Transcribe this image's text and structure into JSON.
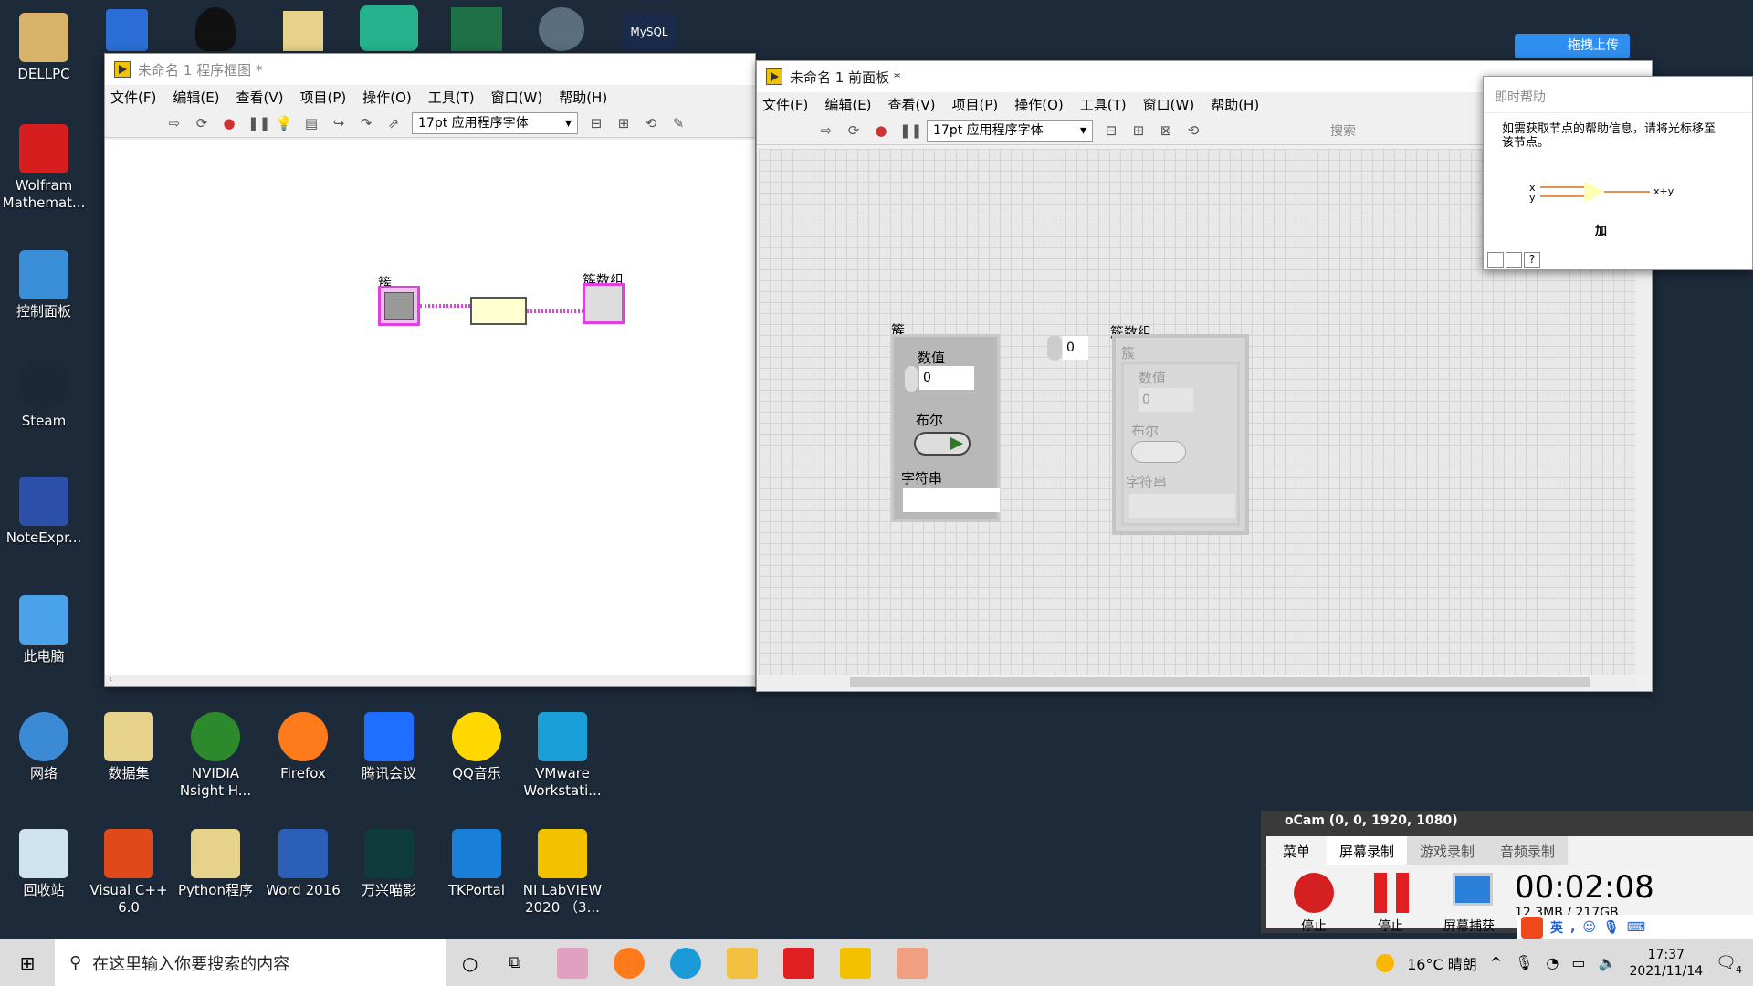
{
  "desktop": {
    "left_icons": [
      "DELLPC",
      "Wolfram Mathemat...",
      "控制面板",
      "Steam",
      "NoteExpr...",
      "此电脑",
      "网络",
      "回收站"
    ],
    "row1": [
      "数据集",
      "NVIDIA Nsight H...",
      "Firefox",
      "腾讯会议",
      "QQ音乐",
      "VMware Workstati..."
    ],
    "row2": [
      "Visual C++ 6.0",
      "Python程序",
      "Word 2016",
      "万兴喵影",
      "TKPortal",
      "NI LabVIEW 2020 （3..."
    ],
    "upload_button": "拖拽上传"
  },
  "menu": [
    "文件(F)",
    "编辑(E)",
    "查看(V)",
    "项目(P)",
    "操作(O)",
    "工具(T)",
    "窗口(W)",
    "帮助(H)"
  ],
  "block_diagram": {
    "title": "未命名 1 程序框图 *",
    "font": "17pt 应用程序字体",
    "cluster_label": "簇",
    "array_label": "簇数组"
  },
  "front_panel": {
    "title": "未命名 1 前面板 *",
    "font": "17pt 应用程序字体",
    "search_placeholder": "搜索",
    "cluster": {
      "label": "簇",
      "numeric_label": "数值",
      "numeric_value": "0",
      "bool_label": "布尔",
      "string_label": "字符串"
    },
    "array": {
      "label": "簇数组",
      "index": "0",
      "cluster_label": "簇",
      "numeric_label": "数值",
      "numeric_value": "0",
      "bool_label": "布尔",
      "string_label": "字符串"
    }
  },
  "context_help": {
    "title": "即时帮助",
    "text": "如需获取节点的帮助信息，请将光标移至该节点。",
    "in_x": "x",
    "in_y": "y",
    "out": "x+y",
    "node_name": "加"
  },
  "ocam": {
    "title": "oCam (0, 0, 1920, 1080)",
    "tabs": [
      "菜单",
      "屏幕录制",
      "游戏录制",
      "音频录制"
    ],
    "buttons": [
      "停止",
      "停止",
      "屏幕捕获"
    ],
    "timer": "00:02:08",
    "size": "12.3MB / 217GB"
  },
  "ime": {
    "lang": "英"
  },
  "taskbar": {
    "search_placeholder": "在这里输入你要搜索的内容",
    "weather": "16°C 晴朗",
    "time": "17:37",
    "date": "2021/11/14",
    "notifications": "4"
  }
}
